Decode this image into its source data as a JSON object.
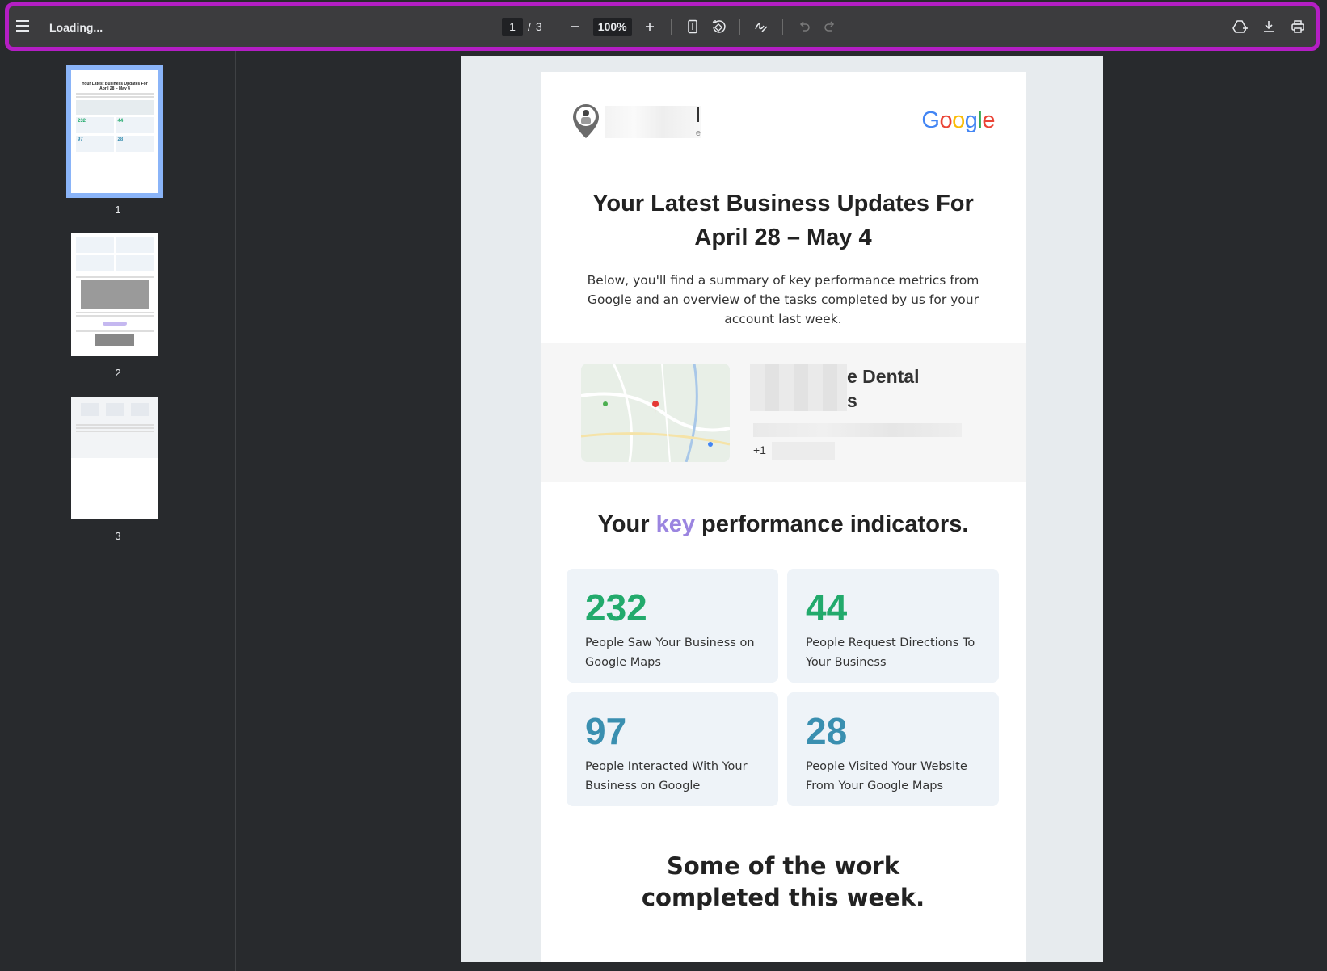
{
  "toolbar": {
    "title": "Loading...",
    "current_page": "1",
    "page_separator": "/",
    "total_pages": "3",
    "zoom": "100%",
    "icons": [
      "menu-icon",
      "zoom-out-icon",
      "zoom-in-icon",
      "fit-page-icon",
      "rotate-icon",
      "annotate-icon",
      "undo-icon",
      "redo-icon",
      "drive-save-icon",
      "download-icon",
      "print-icon"
    ]
  },
  "thumbnails": [
    {
      "label": "1"
    },
    {
      "label": "2"
    },
    {
      "label": "3"
    }
  ],
  "email": {
    "logo_tail": "e",
    "google": "Google",
    "headline_line1": "Your Latest Business Updates For",
    "headline_line2": "April 28 – May 4",
    "intro": "Below, you'll find a summary of key performance metrics from Google and an overview of the tasks completed by us for your account last week.",
    "business_name_line1": "e Dental",
    "business_name_line2": "s",
    "phone_prefix": "+1",
    "kpi_title_before": "Your ",
    "kpi_title_key": "key",
    "kpi_title_after": " performance indicators.",
    "kpis": [
      {
        "value": "232",
        "label": "People Saw Your Business on Google Maps",
        "color": "#22aa6c"
      },
      {
        "value": "44",
        "label": "People Request Directions To Your Business",
        "color": "#22aa6c"
      },
      {
        "value": "97",
        "label": "People Interacted With Your Business on Google",
        "color": "#3a8fb0"
      },
      {
        "value": "28",
        "label": "People Visited Your Website From Your Google Maps",
        "color": "#3a8fb0"
      }
    ],
    "work_title": "Some of the work completed this week."
  },
  "colors": {
    "toolbar_bg": "#3c3c3e",
    "highlight": "#b41ec4",
    "thumb_selected": "#8ab4f8",
    "key_accent": "#9b85e0"
  }
}
